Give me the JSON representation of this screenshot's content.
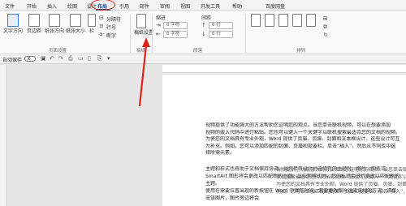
{
  "tabs": [
    {
      "label": "文件",
      "active": false
    },
    {
      "label": "开始",
      "active": false
    },
    {
      "label": "插入",
      "active": false
    },
    {
      "label": "绘图",
      "active": false
    },
    {
      "label": "设计",
      "active": false
    },
    {
      "label": "布局",
      "active": true
    },
    {
      "label": "引用",
      "active": false
    },
    {
      "label": "邮件",
      "active": false
    },
    {
      "label": "审阅",
      "active": false
    },
    {
      "label": "视图",
      "active": false
    },
    {
      "label": "开发工具",
      "active": false
    },
    {
      "label": "帮助",
      "active": false
    },
    {
      "label": "百度网盘",
      "active": false
    }
  ],
  "ribbon": {
    "text_direction": "文字方向",
    "margins": "页边距",
    "orientation": "纸张方向",
    "size": "纸张大小",
    "columns": "栏",
    "breaks": "分隔符",
    "line_numbers": "行号",
    "hyphenation": "断字",
    "page_setup_group": "页面设置",
    "draft": "稿纸设置",
    "draft_group": "稿纸",
    "indent_label": "缩进",
    "indent_left": "0 字符",
    "indent_right": "0 字符",
    "spacing_label": "间距",
    "spacing_before": "0 行",
    "spacing_after": "0 行",
    "paragraph_group": "段落",
    "arrange_group": "排列"
  },
  "qat": {
    "autosave_label": "自动保存",
    "autosave_state": "关"
  },
  "document": {
    "lines": [
      "视频提供了功能强大的方法帮助您证明您的观点。当您单击联机视频，可以在想要添加",
      "视频的嵌入代码中进行粘贴。您也可以键入一个关键字以联机搜索最适合您的文档的视频。",
      "为使您的文档具有专业外观，Word 提供了页眉、页脚、封面和文本框设计，这些设计可互",
      "为补充。例如，您可以添加匹配的封面、页眉和提要栏。单击“插入”，然后从不同库中选",
      "择所需元素。",
      "主题和样式也有助于文档保持协调。当您单击设计并选择新的主题时，图片、图表或",
      "SmartArt 图形将会更改以匹配新的主题。当应用样式时，您的标题会进行更改以匹配新的",
      "主题。",
      "使用在需要位置出现的新按钮在 Word 中保存时间。若要更改图片适应文档的方式，请单",
      "击该图片，图片旁边将会"
    ],
    "overlay_lines": [
      "视频提供了功能强大的方法帮助您证明您的观点。当您单击联机视频，可以",
      "联机搜索最适合您的文档的视频。您也可以键入一个关键字以联机搜索最适合",
      "为使您的文档具有专业外观，Word 提供了页眉、页脚、封面和文本框设计，",
      "例如，您可以添加匹配的封面、页眉和提要栏。单击“插入”，然后"
    ]
  }
}
